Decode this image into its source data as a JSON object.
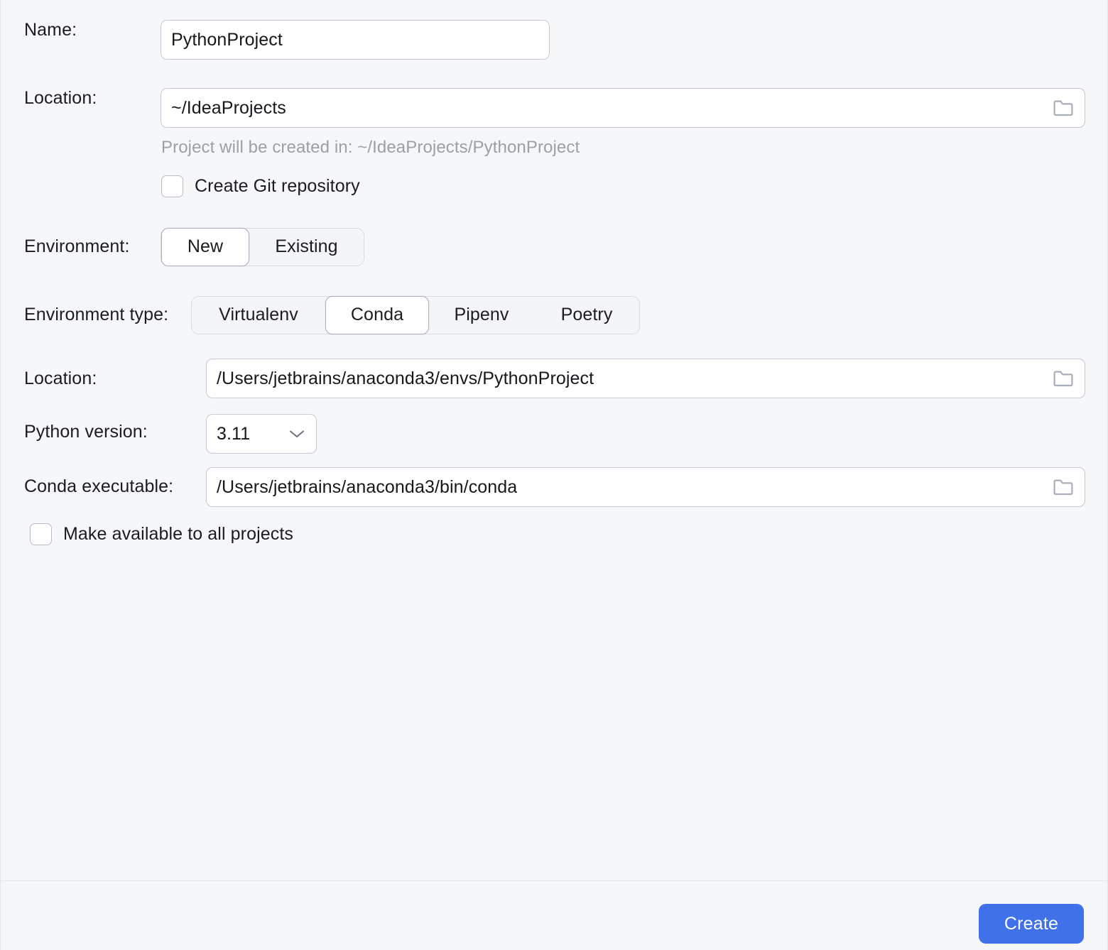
{
  "dialog": {
    "accent_color": "#4071e8",
    "background_color": "#f6f7f9",
    "field_border_color": "#c4c8d2",
    "hint_color": "#9b9fa9"
  },
  "fields": {
    "name": {
      "label": "Name:",
      "value": "PythonProject",
      "placeholder": "PythonProject"
    },
    "location": {
      "label": "Location:",
      "value": "~/IdeaProjects",
      "placeholder": "~/IdeaProjects",
      "browse_icon": "folder-icon"
    },
    "location_hint": "Project will be created in: ~/IdeaProjects/PythonProject",
    "git_checkbox": {
      "label": "Create Git repository",
      "checked": false
    },
    "environment": {
      "label": "Environment:",
      "options": [
        "New",
        "Existing"
      ],
      "selected": "New"
    },
    "environment_type": {
      "label": "Environment type:",
      "options": [
        "Virtualenv",
        "Conda",
        "Pipenv",
        "Poetry"
      ],
      "selected": "Conda"
    },
    "env_location": {
      "label": "Location:",
      "value": "/Users/jetbrains/anaconda3/envs/PythonProject",
      "placeholder": "/Users/jetbrains/anaconda3/envs/PythonProject",
      "browse_icon": "folder-icon"
    },
    "python_version": {
      "label": "Python version:",
      "value": "3.11",
      "options": [
        "3.11"
      ],
      "chevron_icon": "chevron-down-icon"
    },
    "conda_executable": {
      "label": "Conda executable:",
      "value": "/Users/jetbrains/anaconda3/bin/conda",
      "placeholder": "/Users/jetbrains/anaconda3/bin/conda",
      "browse_icon": "folder-icon"
    },
    "make_available_checkbox": {
      "label": "Make available to all projects",
      "checked": false
    }
  },
  "footer": {
    "create_label": "Create"
  }
}
